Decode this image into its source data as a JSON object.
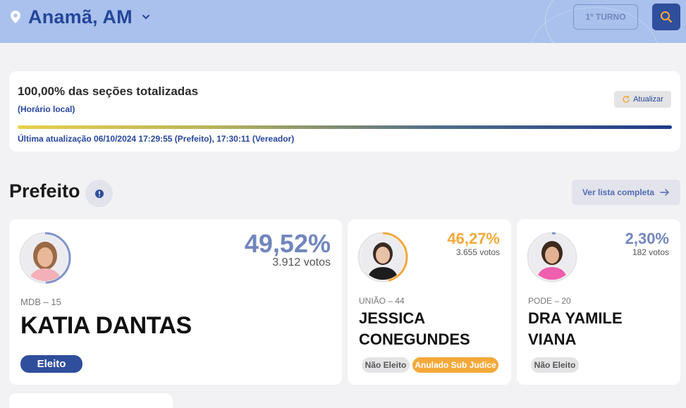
{
  "header": {
    "city": "Anamã, AM",
    "turno_label": "1º TURNO"
  },
  "status": {
    "title": "100,00% das seções totalizadas",
    "subtitle": "(Horário local)",
    "refresh_label": "Atualizar",
    "progress": 1.0,
    "last_update": "Última atualização 06/10/2024 17:29:55 (Prefeito), 17:30:11 (Vereador)"
  },
  "section": {
    "title": "Prefeito",
    "list_button": "Ver lista completa"
  },
  "candidates": [
    {
      "party": "MDB – 15",
      "name_lines": [
        "KATIA DANTAS"
      ],
      "percent": "49,52%",
      "percent_value": 49.52,
      "votes": "3.912 votos",
      "badges": [
        "Eleito"
      ],
      "ring_color": "#7f93c9"
    },
    {
      "party": "UNIÃO – 44",
      "name_lines": [
        "JESSICA",
        "CONEGUNDES"
      ],
      "percent": "46,27%",
      "percent_value": 46.27,
      "votes": "3.655 votos",
      "badges": [
        "Não Eleito",
        "Anulado Sub Judice"
      ],
      "ring_color": "#f4a93a"
    },
    {
      "party": "PODE – 20",
      "name_lines": [
        "DRA YAMILE",
        "VIANA"
      ],
      "percent": "2,30%",
      "percent_value": 2.3,
      "votes": "182 votos",
      "badges": [
        "Não Eleito"
      ],
      "ring_color": "#7f93c9"
    }
  ],
  "colors": {
    "header_bg": "#a9c1ec",
    "brand_blue": "#26469a",
    "eleito_bg": "#2f4e9c",
    "sub_judice_bg": "#f4a93a"
  }
}
